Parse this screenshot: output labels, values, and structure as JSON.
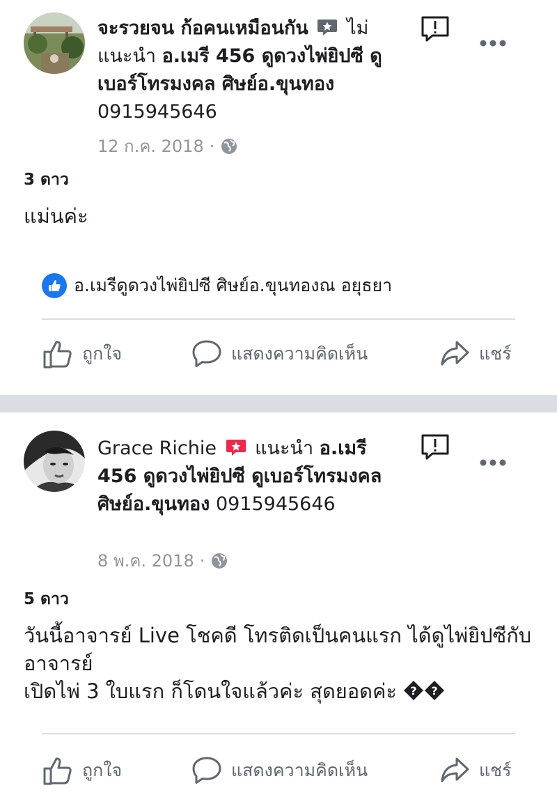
{
  "posts": [
    {
      "author": "จะรวยจน ก้อคนเหมือนกัน",
      "recommend_text": "ไม่แนะนำ",
      "page_name": "อ.เมรี 456 ดูดวงไพ่ยิปซี ดูเบอร์โทรมงคล ศิษย์อ.ขุนทอง",
      "phone": "0915945646",
      "date": "12 ก.ค. 2018",
      "separator": "·",
      "rating": "3 ดาว",
      "body_lines": [
        "แม่นค่ะ"
      ],
      "liked_by": "อ.เมรีดูดวงไพ่ยิปซี ศิษย์อ.ขุนทองณ อยุธยา",
      "actions": {
        "like": "ถูกใจ",
        "comment": "แสดงความคิดเห็น",
        "share": "แชร์"
      }
    },
    {
      "author": "Grace Richie",
      "recommend_text": "แนะนำ",
      "page_name": "อ.เมรี 456 ดูดวงไพ่ยิปซี ดูเบอร์โทรมงคล ศิษย์อ.ขุนทอง",
      "phone": "0915945646",
      "date": "8 พ.ค. 2018",
      "separator": "·",
      "rating": "5 ดาว",
      "body_lines": [
        "วันนี้อาจารย์ Live โชคดี โทรติดเป็นคนแรก ได้ดูไพ่ยิปซีกับอาจารย์",
        "เปิดไพ่ 3 ใบแรก ก็โดนใจแล้วค่ะ สุดยอดค่ะ"
      ],
      "actions": {
        "like": "ถูกใจ",
        "comment": "แสดงความคิดเห็น",
        "share": "แชร์"
      }
    }
  ],
  "colors": {
    "like_blue": "#1877f2",
    "recommend_red": "#f0284a",
    "not_recommend_gray": "#606770",
    "divider": "#dadde1",
    "meta_gray": "#90949c"
  },
  "icons": [
    "star-badge-icon",
    "report-icon",
    "more-options-icon",
    "globe-icon",
    "like-badge-icon",
    "thumbs-up-icon",
    "comment-icon",
    "share-icon",
    "question-emoji-icon"
  ]
}
